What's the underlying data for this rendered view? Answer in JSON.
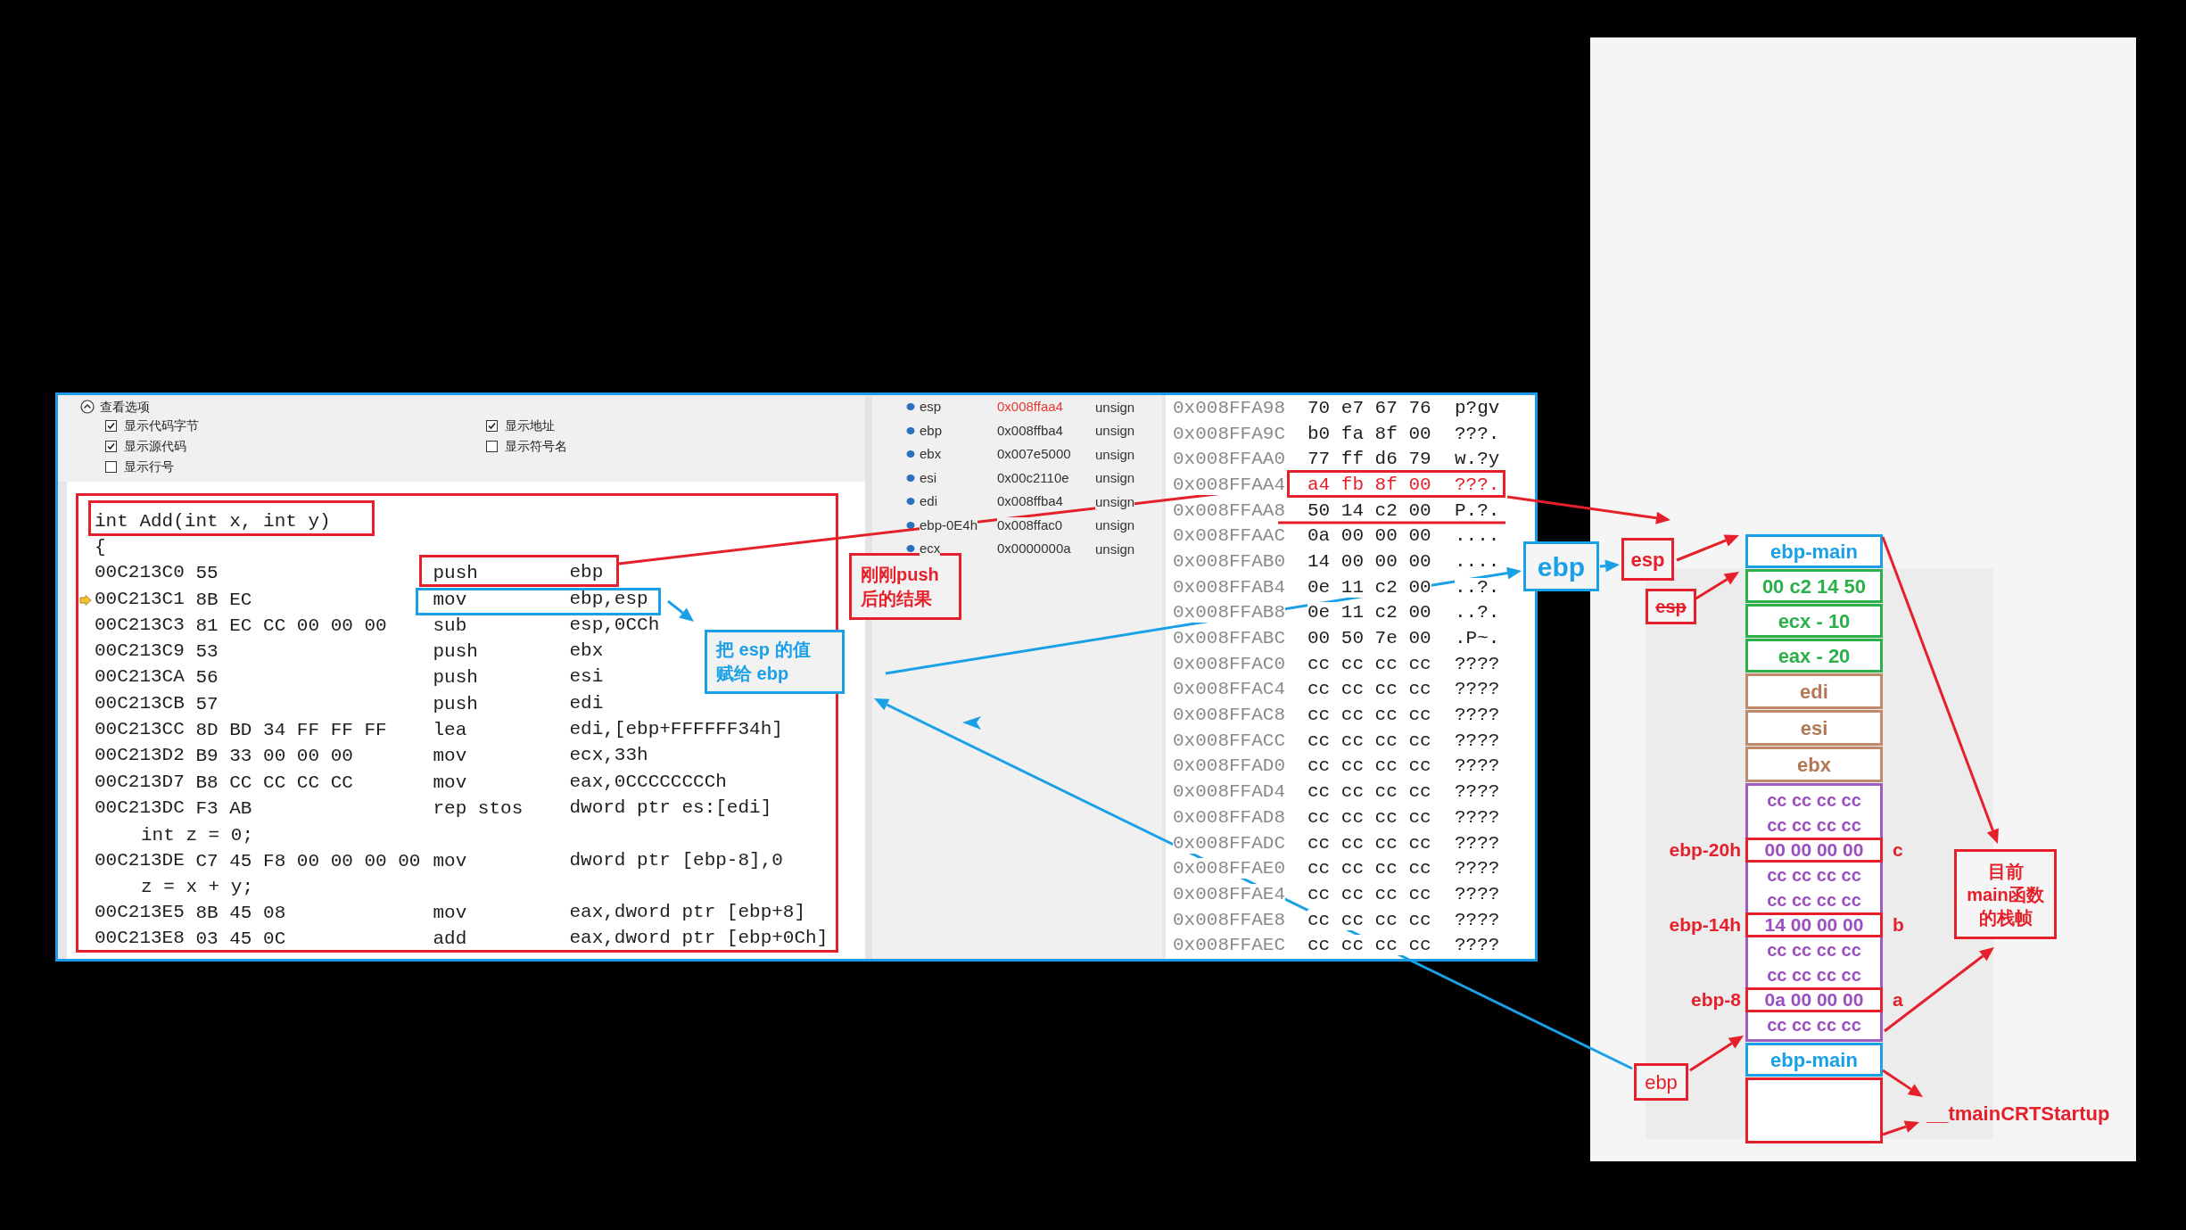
{
  "options": {
    "title": "查看选项",
    "checkboxes": [
      {
        "label": "显示代码字节",
        "checked": true
      },
      {
        "label": "显示源代码",
        "checked": true
      },
      {
        "label": "显示行号",
        "checked": false
      },
      {
        "label": "显示地址",
        "checked": true
      },
      {
        "label": "显示符号名",
        "checked": false
      }
    ]
  },
  "code": [
    {
      "kind": "header",
      "text": "int Add(int x, int y)"
    },
    {
      "kind": "header",
      "text": "{"
    },
    {
      "kind": "asm",
      "address": "00C213C0",
      "bytes": "55",
      "mnemonic": "push",
      "operands": "ebp",
      "current": false
    },
    {
      "kind": "asm",
      "address": "00C213C1",
      "bytes": "8B EC",
      "mnemonic": "mov",
      "operands": "ebp,esp",
      "current": true
    },
    {
      "kind": "asm",
      "address": "00C213C3",
      "bytes": "81 EC CC 00 00 00",
      "mnemonic": "sub",
      "operands": "esp,0CCh",
      "current": false
    },
    {
      "kind": "asm",
      "address": "00C213C9",
      "bytes": "53",
      "mnemonic": "push",
      "operands": "ebx",
      "current": false
    },
    {
      "kind": "asm",
      "address": "00C213CA",
      "bytes": "56",
      "mnemonic": "push",
      "operands": "esi",
      "current": false
    },
    {
      "kind": "asm",
      "address": "00C213CB",
      "bytes": "57",
      "mnemonic": "push",
      "operands": "edi",
      "current": false
    },
    {
      "kind": "asm",
      "address": "00C213CC",
      "bytes": "8D BD 34 FF FF FF",
      "mnemonic": "lea",
      "operands": "edi,[ebp+FFFFFF34h]",
      "current": false
    },
    {
      "kind": "asm",
      "address": "00C213D2",
      "bytes": "B9 33 00 00 00",
      "mnemonic": "mov",
      "operands": "ecx,33h",
      "current": false
    },
    {
      "kind": "asm",
      "address": "00C213D7",
      "bytes": "B8 CC CC CC CC",
      "mnemonic": "mov",
      "operands": "eax,0CCCCCCCCh",
      "current": false
    },
    {
      "kind": "asm",
      "address": "00C213DC",
      "bytes": "F3 AB",
      "mnemonic": "rep stos",
      "operands": "dword ptr es:[edi]",
      "current": false
    },
    {
      "kind": "statement",
      "text": "int z = 0;"
    },
    {
      "kind": "asm",
      "address": "00C213DE",
      "bytes": "C7 45 F8 00 00 00 00",
      "mnemonic": "mov",
      "operands": "dword ptr [ebp-8],0",
      "current": false
    },
    {
      "kind": "statement",
      "text": "z = x + y;"
    },
    {
      "kind": "asm",
      "address": "00C213E5",
      "bytes": "8B 45 08",
      "mnemonic": "mov",
      "operands": "eax,dword ptr [ebp+8]",
      "current": false
    },
    {
      "kind": "asm",
      "address": "00C213E8",
      "bytes": "03 45 0C",
      "mnemonic": "add",
      "operands": "eax,dword ptr [ebp+0Ch]",
      "current": false
    }
  ],
  "registers": [
    {
      "name": "esp",
      "value": "0x008ffaa4",
      "type": "unsign",
      "changed": true
    },
    {
      "name": "ebp",
      "value": "0x008ffba4",
      "type": "unsign",
      "changed": false
    },
    {
      "name": "ebx",
      "value": "0x007e5000",
      "type": "unsign",
      "changed": false
    },
    {
      "name": "esi",
      "value": "0x00c2110e",
      "type": "unsign",
      "changed": false
    },
    {
      "name": "edi",
      "value": "0x008ffba4",
      "type": "unsign",
      "changed": false
    },
    {
      "name": "ebp-0E4h",
      "value": "0x008ffac0",
      "type": "unsign",
      "changed": false
    },
    {
      "name": "ecx",
      "value": "0x0000000a",
      "type": "unsign",
      "changed": false
    }
  ],
  "memory": [
    {
      "address": "0x008FFA98",
      "bytes": "70 e7 67 76",
      "ascii": "p?gv",
      "highlighted": false
    },
    {
      "address": "0x008FFA9C",
      "bytes": "b0 fa 8f 00",
      "ascii": "???.",
      "highlighted": false
    },
    {
      "address": "0x008FFAA0",
      "bytes": "77 ff d6 79",
      "ascii": "w.?y",
      "highlighted": false
    },
    {
      "address": "0x008FFAA4",
      "bytes": "a4 fb 8f 00",
      "ascii": "???.",
      "highlighted": true
    },
    {
      "address": "0x008FFAA8",
      "bytes": "50 14 c2 00",
      "ascii": "P.?.",
      "highlighted": false
    },
    {
      "address": "0x008FFAAC",
      "bytes": "0a 00 00 00",
      "ascii": "....",
      "highlighted": false
    },
    {
      "address": "0x008FFAB0",
      "bytes": "14 00 00 00",
      "ascii": "....",
      "highlighted": false
    },
    {
      "address": "0x008FFAB4",
      "bytes": "0e 11 c2 00",
      "ascii": "..?.",
      "highlighted": false
    },
    {
      "address": "0x008FFAB8",
      "bytes": "0e 11 c2 00",
      "ascii": "..?.",
      "highlighted": false
    },
    {
      "address": "0x008FFABC",
      "bytes": "00 50 7e 00",
      "ascii": ".P~.",
      "highlighted": false
    },
    {
      "address": "0x008FFAC0",
      "bytes": "cc cc cc cc",
      "ascii": "????",
      "highlighted": false
    },
    {
      "address": "0x008FFAC4",
      "bytes": "cc cc cc cc",
      "ascii": "????",
      "highlighted": false
    },
    {
      "address": "0x008FFAC8",
      "bytes": "cc cc cc cc",
      "ascii": "????",
      "highlighted": false
    },
    {
      "address": "0x008FFACC",
      "bytes": "cc cc cc cc",
      "ascii": "????",
      "highlighted": false
    },
    {
      "address": "0x008FFAD0",
      "bytes": "cc cc cc cc",
      "ascii": "????",
      "highlighted": false
    },
    {
      "address": "0x008FFAD4",
      "bytes": "cc cc cc cc",
      "ascii": "????",
      "highlighted": false
    },
    {
      "address": "0x008FFAD8",
      "bytes": "cc cc cc cc",
      "ascii": "????",
      "highlighted": false
    },
    {
      "address": "0x008FFADC",
      "bytes": "cc cc cc cc",
      "ascii": "????",
      "highlighted": false
    },
    {
      "address": "0x008FFAE0",
      "bytes": "cc cc cc cc",
      "ascii": "????",
      "highlighted": false
    },
    {
      "address": "0x008FFAE4",
      "bytes": "cc cc cc cc",
      "ascii": "????",
      "highlighted": false
    },
    {
      "address": "0x008FFAE8",
      "bytes": "cc cc cc cc",
      "ascii": "????",
      "highlighted": false
    },
    {
      "address": "0x008FFAEC",
      "bytes": "cc cc cc cc",
      "ascii": "????",
      "highlighted": false
    }
  ],
  "callouts": [
    {
      "kind": "red",
      "lines": [
        "刚刚push",
        "后的结果"
      ]
    },
    {
      "kind": "blue",
      "lines": [
        "把 esp 的值",
        "赋给 ebp"
      ]
    }
  ],
  "pointers": [
    {
      "kind": "blue",
      "text": "ebp",
      "struck": false
    },
    {
      "kind": "red",
      "text": "esp",
      "struck": false
    },
    {
      "kind": "red",
      "text": "esp",
      "struck": true
    },
    {
      "kind": "red",
      "text": "ebp",
      "struck": false
    }
  ],
  "stack": [
    {
      "kind": "frame",
      "text": "ebp-main"
    },
    {
      "kind": "saved",
      "text": "00 c2 14 50"
    },
    {
      "kind": "saved",
      "text": "ecx - 10"
    },
    {
      "kind": "saved",
      "text": "eax - 20"
    },
    {
      "kind": "register",
      "text": "edi"
    },
    {
      "kind": "register",
      "text": "esi"
    },
    {
      "kind": "register",
      "text": "ebx"
    },
    {
      "kind": "locals",
      "rows": [
        {
          "kind": "fill",
          "text": "cc cc cc cc"
        },
        {
          "kind": "fill",
          "text": "cc cc cc cc"
        },
        {
          "kind": "variable",
          "text": "00 00 00 00",
          "offset": "ebp-20h",
          "name": "c"
        },
        {
          "kind": "fill",
          "text": "cc cc cc cc"
        },
        {
          "kind": "fill",
          "text": "cc cc cc cc"
        },
        {
          "kind": "variable",
          "text": "14 00 00 00",
          "offset": "ebp-14h",
          "name": "b"
        },
        {
          "kind": "fill",
          "text": "cc cc cc cc"
        },
        {
          "kind": "fill",
          "text": "cc cc cc cc"
        },
        {
          "kind": "variable",
          "text": "0a 00 00 00",
          "offset": "ebp-8",
          "name": "a"
        },
        {
          "kind": "fill",
          "text": "cc cc cc cc"
        }
      ]
    },
    {
      "kind": "frame",
      "text": "ebp-main"
    },
    {
      "kind": "empty"
    }
  ],
  "frame_note": [
    "目前",
    "main函数",
    "的栈帧"
  ],
  "caller_label": "__tmainCRTStartup"
}
